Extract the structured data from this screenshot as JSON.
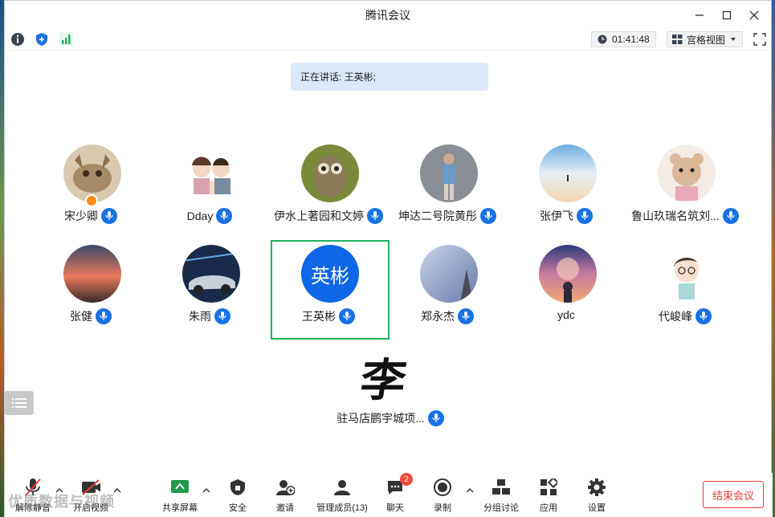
{
  "window": {
    "title": "腾讯会议"
  },
  "toolbar": {
    "timer": "01:41:48",
    "view_label": "宫格视图"
  },
  "speaking": {
    "text": "正在讲话: 王英彬;"
  },
  "participants": [
    {
      "name": "宋少卿",
      "host": true
    },
    {
      "name": "Dday"
    },
    {
      "name": "伊水上著园和文婷"
    },
    {
      "name": "坤达二号院黄彤"
    },
    {
      "name": "张伊飞"
    },
    {
      "name": "鲁山玖瑞名筑刘..."
    },
    {
      "name": "张健"
    },
    {
      "name": "朱雨"
    },
    {
      "name": "王英彬",
      "avatar_text": "英彬"
    },
    {
      "name": "郑永杰"
    },
    {
      "name": "ydc"
    },
    {
      "name": "代峻峰"
    },
    {
      "name": "驻马店鹏宇城项...",
      "avatar_text": "李"
    }
  ],
  "bottom": {
    "unmute": "解除静音",
    "video": "开启视频",
    "share": "共享屏幕",
    "security": "安全",
    "invite": "邀请",
    "members": "管理成员(13)",
    "chat": "聊天",
    "chat_badge": "2",
    "record": "录制",
    "breakout": "分组讨论",
    "apps": "应用",
    "settings": "设置",
    "end": "结束会议"
  },
  "watermark": "优质数据与视频",
  "colors": {
    "accent": "#1672e5",
    "end": "#e83b3b",
    "highlight": "#22b05e"
  }
}
